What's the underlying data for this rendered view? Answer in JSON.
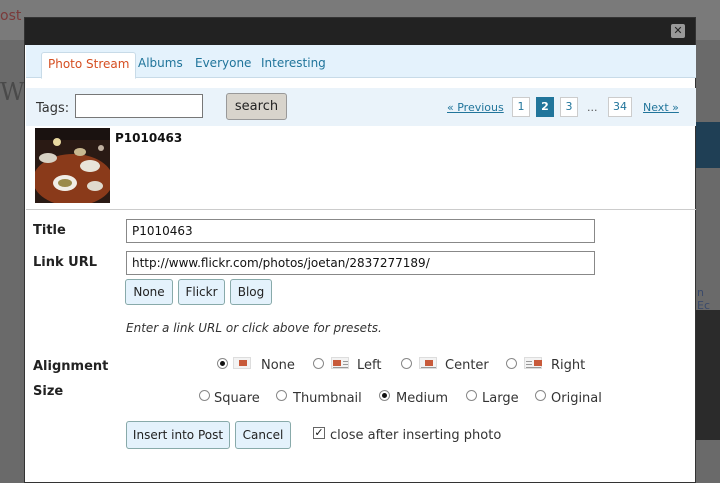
{
  "background": {
    "top_text": "ost",
    "heading": "Wri",
    "right_link": "n Ec"
  },
  "modal": {
    "close_glyph": "✕"
  },
  "tabs": [
    {
      "label": "Photo Stream",
      "active": true
    },
    {
      "label": "Albums",
      "active": false
    },
    {
      "label": "Everyone",
      "active": false
    },
    {
      "label": "Interesting",
      "active": false
    }
  ],
  "search": {
    "tags_label": "Tags:",
    "tags_value": "",
    "button_label": "search"
  },
  "pager": {
    "previous": "« Previous",
    "pages": [
      "1",
      "2",
      "3"
    ],
    "current": "2",
    "ellipsis": "...",
    "last": "34",
    "next": "Next »"
  },
  "photo": {
    "name": "P1010463"
  },
  "form": {
    "title_label": "Title",
    "title_value": "P1010463",
    "link_label": "Link URL",
    "link_value": "http://www.flickr.com/photos/joetan/2837277189/",
    "presets": [
      "None",
      "Flickr",
      "Blog"
    ],
    "hint": "Enter a link URL or click above for presets.",
    "alignment_label": "Alignment",
    "alignment_options": [
      {
        "label": "None",
        "checked": true
      },
      {
        "label": "Left",
        "checked": false
      },
      {
        "label": "Center",
        "checked": false
      },
      {
        "label": "Right",
        "checked": false
      }
    ],
    "size_label": "Size",
    "size_options": [
      {
        "label": "Square",
        "checked": false
      },
      {
        "label": "Thumbnail",
        "checked": false
      },
      {
        "label": "Medium",
        "checked": true
      },
      {
        "label": "Large",
        "checked": false
      },
      {
        "label": "Original",
        "checked": false
      }
    ],
    "insert_label": "Insert into Post",
    "cancel_label": "Cancel",
    "close_after_label": "close after inserting photo",
    "close_after_checked": true
  },
  "colors": {
    "accent_link": "#21759b",
    "active_tab": "#d54e21",
    "tab_bar_bg": "#e4f2fc"
  }
}
